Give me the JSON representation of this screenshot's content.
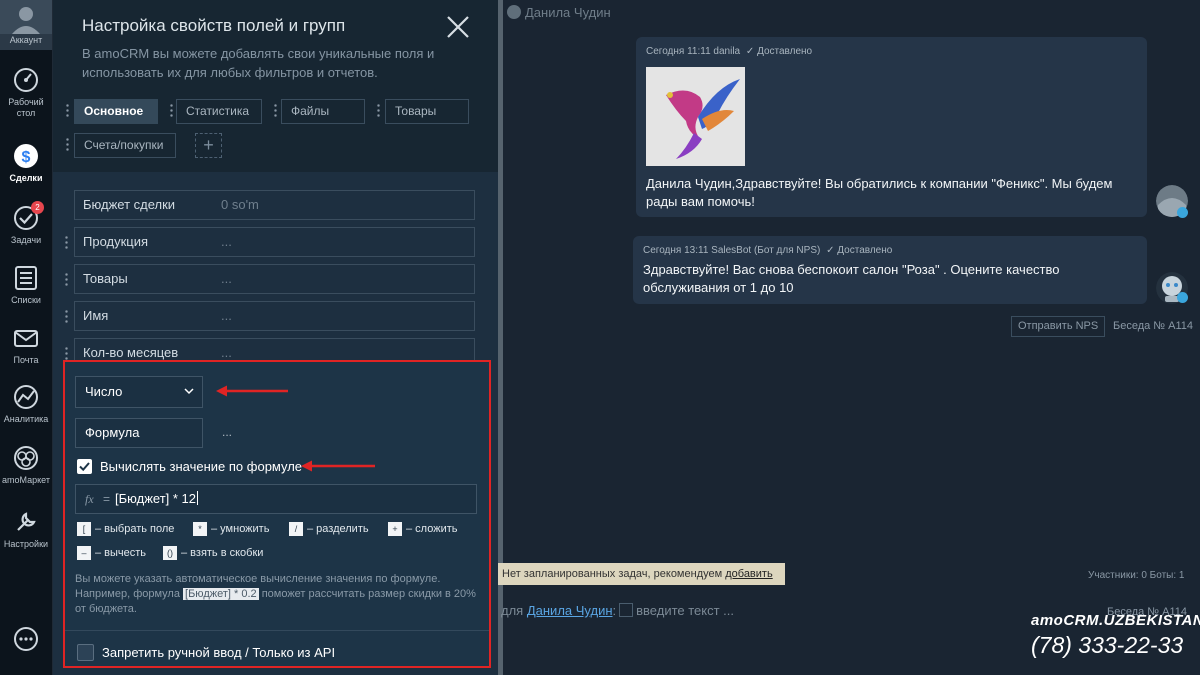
{
  "nav": {
    "account": "Аккаунт",
    "dashboard": "Рабочий стол",
    "deals": "Сделки",
    "tasks": "Задачи",
    "tasks_badge": "2",
    "lists": "Списки",
    "mail": "Почта",
    "analytics": "Аналитика",
    "market": "amoМаркет",
    "settings": "Настройки"
  },
  "panel": {
    "title": "Настройка свойств полей и групп",
    "description": "В amoCRM вы можете добавлять свои уникальные поля и использовать их для любых фильтров и отчетов.",
    "tabs": [
      "Основное",
      "Статистика",
      "Файлы",
      "Товары",
      "Счета/покупки"
    ],
    "tab_add": "+",
    "fields": [
      {
        "name": "Бюджет сделки",
        "value": "0 so'm"
      },
      {
        "name": "Продукция",
        "value": "..."
      },
      {
        "name": "Товары",
        "value": "..."
      },
      {
        "name": "Имя",
        "value": "..."
      },
      {
        "name": "Кол-во месяцев",
        "value": "..."
      }
    ]
  },
  "editor": {
    "type_value": "Число",
    "formula_name": "Формула",
    "formula_dots": "...",
    "calc_label": "Вычислять значение по формуле",
    "fx": "fx",
    "eq": "=",
    "formula": "[Бюджет] * 12",
    "ops": [
      {
        "key": "[",
        "label": "– выбрать поле"
      },
      {
        "key": "*",
        "label": "– умножить"
      },
      {
        "key": "/",
        "label": "– разделить"
      },
      {
        "key": "+",
        "label": "– сложить"
      },
      {
        "key": "–",
        "label": "– вычесть"
      },
      {
        "key": "()",
        "label": "– взять в скобки"
      }
    ],
    "note_1": "Вы можете указать автоматическое вычисление значения по формуле. Например, формула",
    "note_chip": "[Бюджет] * 0.2",
    "note_2": "поможет рассчитать размер скидки в 20% от бюджета.",
    "api_label": "Запретить ручной ввод / Только из API"
  },
  "chat": {
    "top_name": "Данила Чудин",
    "msg1": {
      "meta": "Сегодня 11:11 danila",
      "status": "Доставлено",
      "text": "Данила Чудин,Здравствуйте! Вы обратились к компании \"Феникс\". Мы будем рады вам помочь!"
    },
    "msg2": {
      "meta": "Сегодня 13:11 SalesBot (Бот для NPS)",
      "status": "Доставлено",
      "text": "Здравствуйте! Вас снова беспокоит салон \"Роза\" . Оцените качество обслуживания от 1 до 10"
    },
    "send_nps": "Отправить NPS",
    "conv_num": "Беседа № А114",
    "tasks_text": "Нет запланированных задач, рекомендуем",
    "tasks_link": "добавить",
    "participants": "Участники: 0   Боты: 1",
    "reply_prefix": "для",
    "reply_name": "Данила Чудин",
    "reply_colon": ":",
    "reply_placeholder": "введите текст ..."
  },
  "brand": {
    "name": "amoCRM.UZBEKISTAN",
    "phone": "(78) 333-22-33"
  },
  "colors": {
    "highlight_red": "#e02424",
    "telegram": "#3aa6dd",
    "badge_red": "#e6464e"
  },
  "icons": [
    "avatar-icon",
    "dashboard-icon",
    "deals-icon",
    "tasks-icon",
    "lists-icon",
    "mail-icon",
    "analytics-icon",
    "market-icon",
    "settings-icon",
    "chat-icon",
    "close-icon",
    "chevron-down-icon",
    "check-icon",
    "telegram-icon"
  ]
}
